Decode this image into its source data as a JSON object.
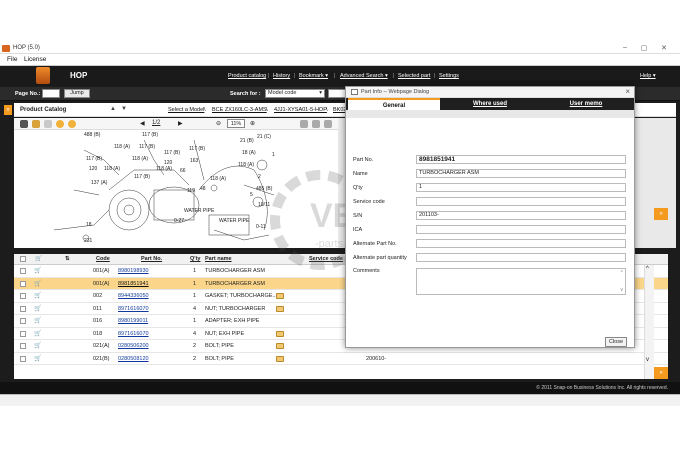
{
  "window": {
    "title": "HOP (5.0)",
    "controls": [
      "–",
      "▢",
      "✕"
    ]
  },
  "menu": [
    "File",
    "License"
  ],
  "header": {
    "app_name": "HOP",
    "nav": [
      "Product catalog",
      "History",
      "Bookmark ▾",
      "Advanced Search ▾",
      "Selected part",
      "Settings"
    ],
    "help": "Help ▾"
  },
  "toolbar": {
    "page_label": "Page No.:",
    "jump_label": "Jump",
    "search_label": "Search for :",
    "search_mode": "Model code",
    "daily_label": "ly"
  },
  "catalog": {
    "title": "Product Catalog",
    "breadcrumb": [
      "Select a Model",
      "BCE ZX160LC-3-AMS",
      "4JJ1-XYSA01-5-HOP",
      "BK02"
    ]
  },
  "diagram": {
    "page": "1/2",
    "zoom": "11%",
    "labels": [
      "488 (B)",
      "117 (B)",
      "118 (A)",
      "117 (B)",
      "117 (B)",
      "120",
      "118 (A)",
      "137 (A)",
      "117 (B)",
      "118 (A)",
      "117 (B)",
      "118 (A)",
      "117 (B)",
      "163",
      "120",
      "66",
      "118 (A)",
      "48",
      "119",
      "21 (C)",
      "21 (B)",
      "18 (A)",
      "1",
      "2",
      "118 (A)",
      "485 (B)",
      "5",
      "WATER PIPE",
      "0-27",
      "WATER PIPE",
      "0-11",
      "18",
      "231",
      "10/11"
    ]
  },
  "grid": {
    "headers": [
      "Code",
      "Part No.",
      "Q'ty",
      "Part name",
      "Service code",
      "tity"
    ],
    "rows": [
      {
        "code": "001(A)",
        "part_no": "8980198930",
        "qty": "1",
        "name": "TURBOCHARGER ASM",
        "service": "",
        "selected": false,
        "icon": false
      },
      {
        "code": "001(A)",
        "part_no": "8981851941",
        "qty": "1",
        "name": "TURBOCHARGER ASM",
        "service": "",
        "selected": true,
        "icon": false
      },
      {
        "code": "002",
        "part_no": "8944336050",
        "qty": "1",
        "name": "GASKET; TURBOCHARGE...",
        "service": "",
        "selected": false,
        "icon": true
      },
      {
        "code": "011",
        "part_no": "8971616070",
        "qty": "4",
        "name": "NUT; TURBOCHARGER",
        "service": "",
        "selected": false,
        "icon": true
      },
      {
        "code": "016",
        "part_no": "8980199011",
        "qty": "1",
        "name": "ADAPTER; EXH PIPE",
        "service": "",
        "selected": false,
        "icon": false
      },
      {
        "code": "018",
        "part_no": "8971616070",
        "qty": "4",
        "name": "NUT; EXH PIPE",
        "service": "",
        "selected": false,
        "icon": true
      },
      {
        "code": "021(A)",
        "part_no": "0280506200",
        "qty": "2",
        "name": "BOLT; PIPE",
        "service": "",
        "selected": false,
        "icon": true
      },
      {
        "code": "021(B)",
        "part_no": "0280508120",
        "qty": "2",
        "name": "BOLT; PIPE",
        "service": "200610-",
        "selected": false,
        "icon": true
      }
    ]
  },
  "footer": {
    "copyright": "© 2011 Snap-on Business Solutions Inc. All rights reserved."
  },
  "dialog": {
    "title": "Part Info -- Webpage Dialog",
    "tabs": [
      "General",
      "Where used",
      "User memo"
    ],
    "fields": [
      {
        "label": "Part No.",
        "value": "8981851941"
      },
      {
        "label": "Name",
        "value": "TURBOCHARGER ASM"
      },
      {
        "label": "Q'ty",
        "value": "1"
      },
      {
        "label": "Service code",
        "value": ""
      },
      {
        "label": "S/N",
        "value": "201103-"
      },
      {
        "label": "ICA",
        "value": ""
      },
      {
        "label": "Alternate Part No.",
        "value": ""
      },
      {
        "label": "Alternate part quantity",
        "value": ""
      }
    ],
    "comments_label": "Comments",
    "close_label": "Close"
  },
  "watermark": {
    "line1": "VET",
    "line2": "-parts.com"
  },
  "colors": {
    "accent": "#f39a1f",
    "header_bg": "#1a1a1a",
    "selected_row": "#fbd68a",
    "link": "#123a9c"
  }
}
